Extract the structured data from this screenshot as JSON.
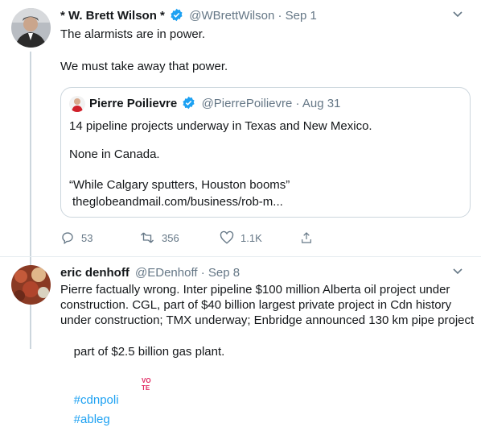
{
  "tweet1": {
    "name": "* W. Brett Wilson *",
    "handle": "@WBrettWilson",
    "date": "Sep 1",
    "text_line1": "The alarmists are in power.",
    "text_line2": "We must take away that power.",
    "quote": {
      "name": "Pierre Poilievre",
      "handle": "@PierrePoilievre",
      "date": "Aug 31",
      "line1": "14 pipeline projects underway in Texas and New Mexico.",
      "line2": "None in Canada.",
      "line3": "“While Calgary sputters, Houston booms”",
      "link": "theglobeandmail.com/business/rob-m..."
    },
    "actions": {
      "replies": "53",
      "retweets": "356",
      "likes": "1.1K"
    }
  },
  "tweet2": {
    "name": "eric denhoff",
    "handle": "@EDenhoff",
    "date": "Sep 8",
    "line1": "Pierre factually wrong. Inter pipeline $100 million Alberta oil project under",
    "line2": "construction. CGL, part of $40 billion largest private project in Cdn history",
    "line3": "under construction; TMX underway; Enbridge announced 130 km pipe project",
    "line4_prefix": "part of $2.5 billion gas plant.",
    "hashtag1": "#cdnpoli",
    "hashtag2": "#ableg",
    "emoji_text": "VOTE"
  },
  "colors": {
    "accent": "#1da1f2",
    "muted": "#657786",
    "text": "#14171a"
  }
}
